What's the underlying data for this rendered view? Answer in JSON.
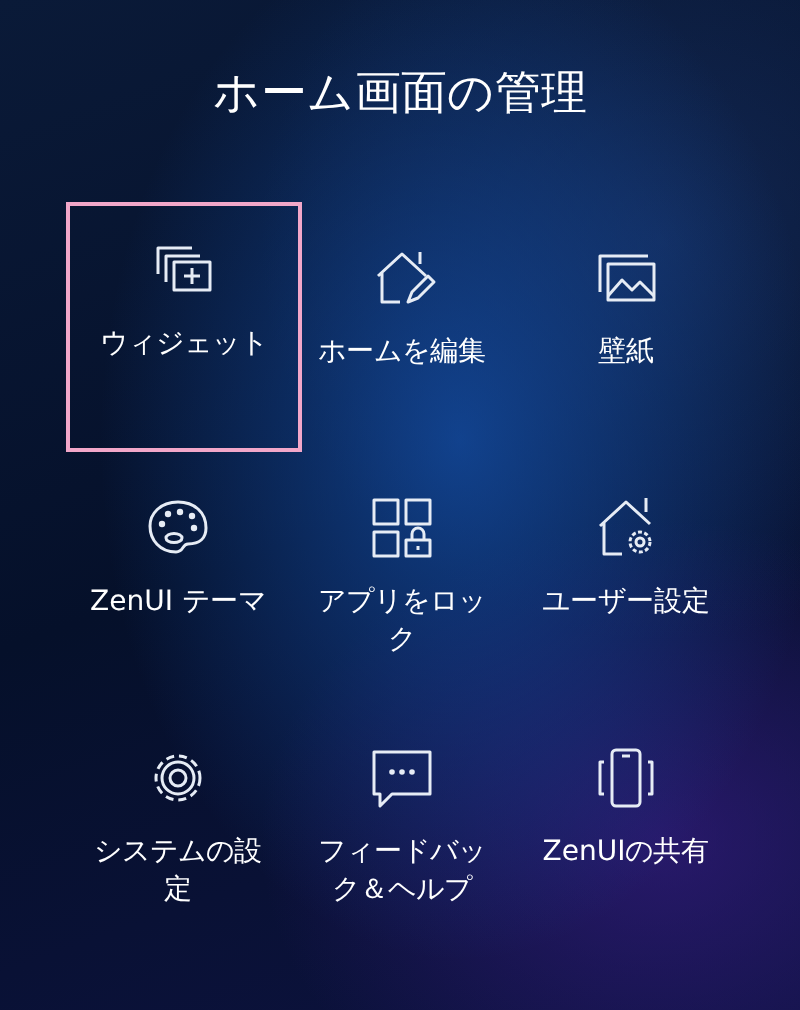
{
  "title": "ホーム画面の管理",
  "items": [
    {
      "kind": "widget",
      "label": "ウィジェット",
      "selected": true
    },
    {
      "kind": "homeedit",
      "label": "ホームを編集",
      "selected": false
    },
    {
      "kind": "wallpaper",
      "label": "壁紙",
      "selected": false
    },
    {
      "kind": "theme",
      "label": "ZenUI テーマ",
      "selected": false
    },
    {
      "kind": "applock",
      "label": "アプリをロック",
      "selected": false
    },
    {
      "kind": "prefs",
      "label": "ユーザー設定",
      "selected": false
    },
    {
      "kind": "settings",
      "label": "システムの設定",
      "selected": false
    },
    {
      "kind": "feedback",
      "label": "フィードバック＆ヘルプ",
      "selected": false
    },
    {
      "kind": "share",
      "label": "ZenUIの共有",
      "selected": false
    }
  ]
}
